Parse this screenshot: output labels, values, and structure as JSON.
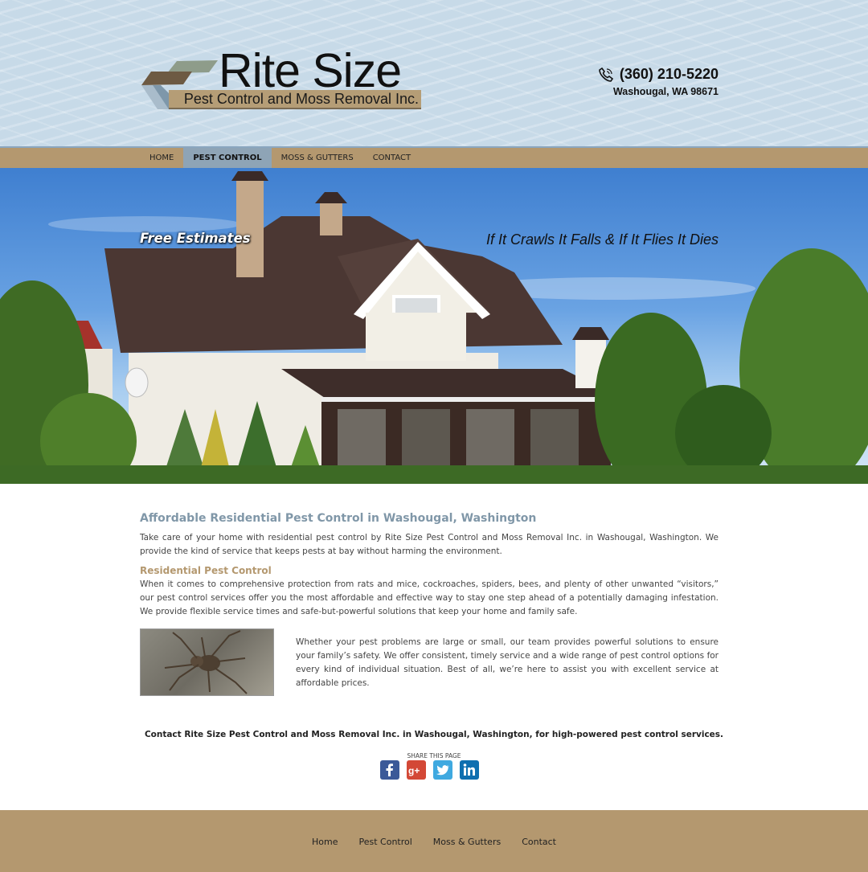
{
  "header": {
    "logo_title": "Rite Size",
    "logo_subtitle": "Pest Control and Moss Removal Inc.",
    "phone": "(360) 210-5220",
    "address": "Washougal, WA 98671"
  },
  "nav": {
    "items": [
      {
        "label": "HOME"
      },
      {
        "label": "PEST CONTROL"
      },
      {
        "label": "MOSS & GUTTERS"
      },
      {
        "label": "CONTACT"
      }
    ],
    "active": "PEST CONTROL"
  },
  "hero": {
    "left_text": "Free Estimates",
    "right_text": "If It Crawls It Falls & If It Flies It Dies"
  },
  "main": {
    "heading": "Affordable Residential Pest Control in Washougal, Washington",
    "intro": "Take care of your home with residential pest control by Rite Size Pest Control and Moss Removal Inc. in Washougal, Washington. We provide the kind of service that keeps pests at bay without harming the environment.",
    "subheading": "Residential Pest Control",
    "paragraph1": "When it comes to comprehensive protection from rats and mice, cockroaches, spiders, bees, and plenty of other unwanted “visitors,” our pest control services offer you the most affordable and effective way to stay one step ahead of a potentially damaging infestation. We provide flexible service times and safe-but-powerful solutions that keep your home and family safe.",
    "paragraph2": "Whether your pest problems are large or small, our team provides powerful solutions to ensure your family’s safety. We offer consistent, timely service and a wide range of pest control options for every kind of individual situation. Best of all, we’re here to assist you with excellent service at affordable prices.",
    "cta": "Contact Rite Size Pest Control and Moss Removal Inc. in Washougal, Washington, for high-powered pest control services."
  },
  "share": {
    "label": "SHARE THIS PAGE",
    "icons": [
      "facebook-icon",
      "google-plus-icon",
      "twitter-icon",
      "linkedin-icon"
    ],
    "colors": {
      "facebook": "#3b5998",
      "google_plus": "#d34836",
      "twitter": "#3fa9e0",
      "linkedin": "#0f6fb0"
    }
  },
  "footer": {
    "links": [
      {
        "label": "Home"
      },
      {
        "label": "Pest Control"
      },
      {
        "label": "Moss & Gutters"
      },
      {
        "label": "Contact"
      }
    ]
  },
  "colors": {
    "header_bg": "#cfe0ec",
    "nav_bg": "#b4986f",
    "nav_active": "#8ea4b6",
    "heading": "#8097a8",
    "subheading": "#b4986f",
    "footer_bg": "#b4986f"
  }
}
